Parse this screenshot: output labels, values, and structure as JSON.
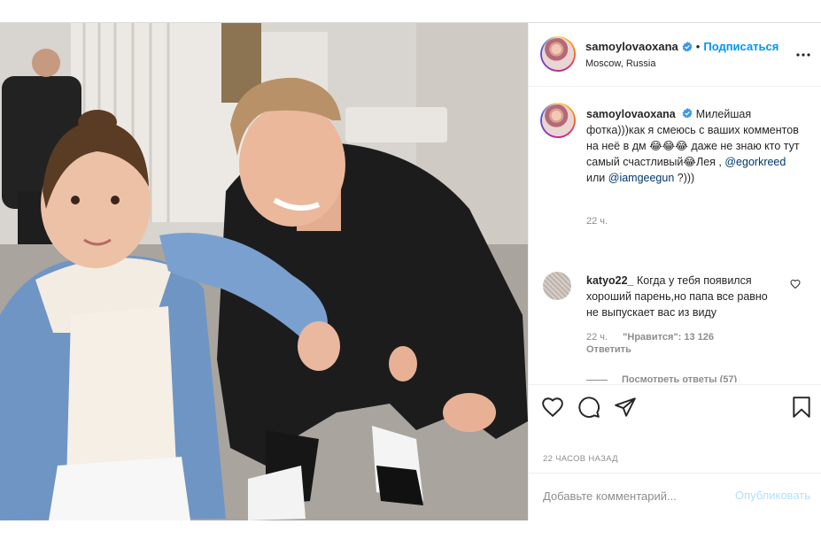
{
  "post": {
    "author": {
      "username": "samoylovaoxana",
      "location": "Moscow, Russia",
      "follow_label": "Подписаться",
      "separator": "•"
    },
    "caption": {
      "username": "samoylovaoxana",
      "text_part1": "Милейшая фотка)))как я смеюсь с ваших комментов на неё в дм 😂😂😂 даже не знаю кто тут самый счастливый😂Лея ,",
      "mention1": "@egorkreed",
      "text_part2": "или",
      "mention2": "@iamgeegun",
      "text_part3": "?)))",
      "time": "22 ч."
    },
    "comment": {
      "username": "katyo22_",
      "text": "Когда у тебя появился хороший парень,но папа все равно не выпускает вас из виду",
      "time": "22 ч.",
      "likes": "\"Нравится\": 13 126",
      "reply_label": "Ответить",
      "view_replies": "Посмотреть ответы (57)"
    },
    "timestamp": "22 часов назад",
    "add_comment": {
      "placeholder": "Добавьте комментарий...",
      "publish_label": "Опубликовать"
    }
  },
  "icons": {
    "like": "heart-icon",
    "comment": "comment-icon",
    "share": "share-icon",
    "save": "bookmark-icon",
    "more": "more-icon",
    "verified": "verified-badge-icon"
  },
  "colors": {
    "link_blue": "#0095f6",
    "mention_blue": "#00376b",
    "muted_text": "#8e8e8e",
    "publish_disabled": "#b2dffc"
  }
}
